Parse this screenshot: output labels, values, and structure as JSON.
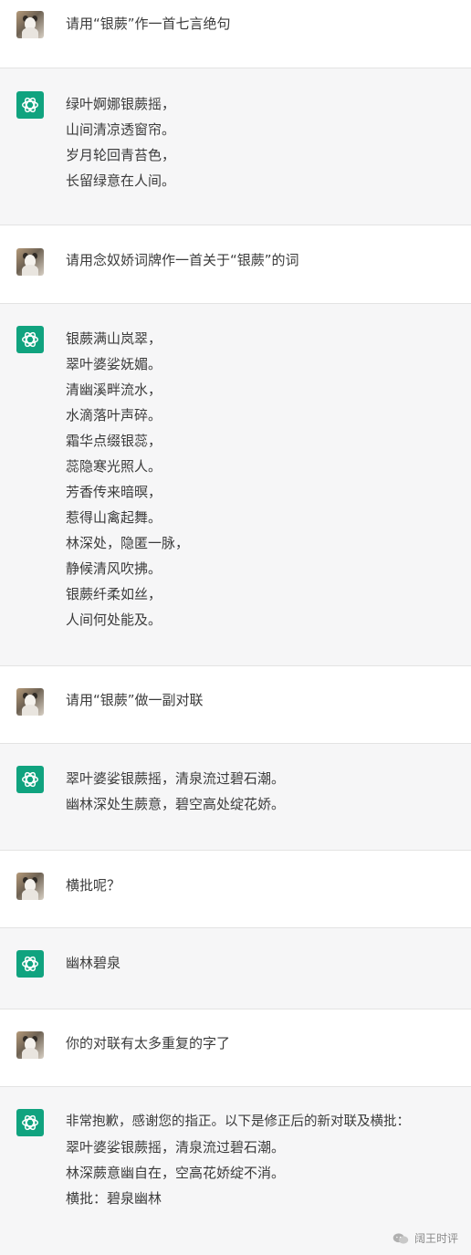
{
  "conversation": [
    {
      "role": "user",
      "lines": [
        "请用“银蕨”作一首七言绝句"
      ]
    },
    {
      "role": "assistant",
      "lines": [
        "绿叶婀娜银蕨摇，",
        "山间清凉透窗帘。",
        "岁月轮回青苔色，",
        "长留绿意在人间。"
      ]
    },
    {
      "role": "user",
      "lines": [
        "请用念奴娇词牌作一首关于“银蕨”的词"
      ]
    },
    {
      "role": "assistant",
      "lines": [
        "银蕨满山岚翠，",
        "翠叶婆娑妩媚。",
        "清幽溪畔流水，",
        "水滴落叶声碎。",
        "霜华点缀银蕊，",
        "蕊隐寒光照人。",
        "芳香传来暗暝，",
        "惹得山禽起舞。",
        "林深处，隐匿一脉，",
        "静候清风吹拂。",
        "银蕨纤柔如丝，",
        "人间何处能及。"
      ]
    },
    {
      "role": "user",
      "lines": [
        "请用“银蕨”做一副对联"
      ]
    },
    {
      "role": "assistant",
      "lines": [
        "翠叶婆娑银蕨摇，清泉流过碧石潮。",
        "幽林深处生蕨意，碧空高处绽花娇。"
      ]
    },
    {
      "role": "user",
      "lines": [
        "横批呢？"
      ]
    },
    {
      "role": "assistant",
      "lines": [
        "幽林碧泉"
      ]
    },
    {
      "role": "user",
      "lines": [
        "你的对联有太多重复的字了"
      ]
    },
    {
      "role": "assistant",
      "lines": [
        "非常抱歉，感谢您的指正。以下是修正后的新对联及横批：",
        "翠叶婆娑银蕨摇，清泉流过碧石潮。",
        "林深蕨意幽自在，空高花娇绽不消。",
        "横批：碧泉幽林"
      ]
    }
  ],
  "watermark": {
    "text": "阔王时评",
    "icon": "wechat-icon"
  },
  "colors": {
    "assistant_bg": "#f6f6f7",
    "user_bg": "#ffffff",
    "gpt_logo": "#10a37f",
    "divider": "#e3e3e3"
  }
}
